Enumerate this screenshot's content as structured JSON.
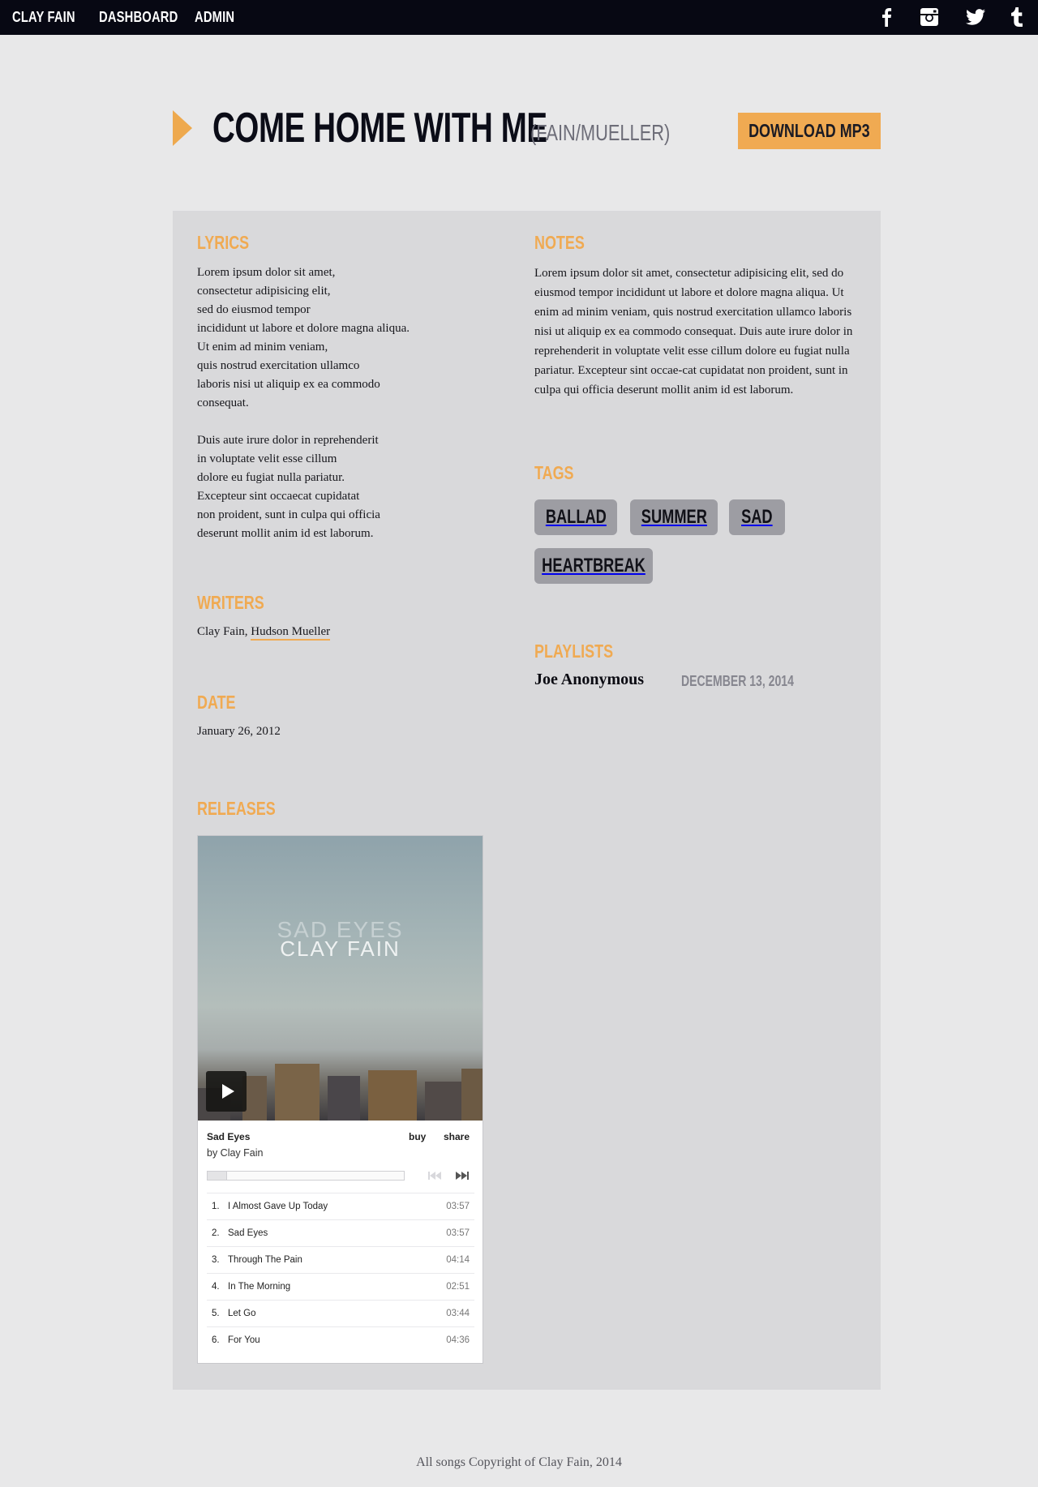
{
  "nav": {
    "brand": "CLAY FAIN",
    "links": [
      "DASHBOARD",
      "ADMIN"
    ],
    "social": [
      "facebook-icon",
      "instagram-icon",
      "twitter-icon",
      "tumblr-icon"
    ]
  },
  "song": {
    "title": "COME HOME WITH ME",
    "credit": "(FAIN/MUELLER)",
    "download_label": "DOWNLOAD MP3"
  },
  "lyrics": {
    "heading": "LYRICS",
    "lines": [
      "Lorem ipsum dolor sit amet,",
      "consectetur adipisicing elit,",
      "sed do eiusmod tempor",
      "incididunt ut labore et dolore magna aliqua.",
      "Ut enim ad minim veniam,",
      "quis nostrud exercitation ullamco",
      "laboris nisi ut aliquip ex ea commodo",
      "consequat.",
      "",
      "Duis aute irure dolor in reprehenderit",
      "in voluptate velit esse cillum",
      "dolore eu fugiat nulla pariatur.",
      "Excepteur sint occaecat cupidatat",
      "non proident, sunt in culpa qui officia",
      "deserunt mollit anim id est laborum."
    ]
  },
  "writers": {
    "heading": "WRITERS",
    "plain": "Clay Fain, ",
    "linked": "Hudson Mueller"
  },
  "date": {
    "heading": "DATE",
    "value": "January 26, 2012"
  },
  "releases": {
    "heading": "RELEASES",
    "cover_line1": "SAD EYES",
    "cover_line2": "CLAY FAIN",
    "album_title": "Sad Eyes",
    "album_artist": "by Clay Fain",
    "buy_label": "buy",
    "share_label": "share",
    "progress": 0.1,
    "tracks": [
      {
        "num": "1.",
        "name": "I Almost Gave Up Today",
        "time": "03:57"
      },
      {
        "num": "2.",
        "name": "Sad Eyes",
        "time": "03:57"
      },
      {
        "num": "3.",
        "name": "Through The Pain",
        "time": "04:14"
      },
      {
        "num": "4.",
        "name": "In The Morning",
        "time": "02:51"
      },
      {
        "num": "5.",
        "name": "Let Go",
        "time": "03:44"
      },
      {
        "num": "6.",
        "name": "For You",
        "time": "04:36"
      }
    ]
  },
  "notes": {
    "heading": "NOTES",
    "text": "Lorem ipsum dolor sit amet, consectetur adipisicing elit, sed do eiusmod tempor incididunt ut labore et dolore magna aliqua. Ut enim ad minim veniam, quis nostrud exercitation ullamco laboris nisi ut aliquip ex ea commodo consequat. Duis aute irure dolor in reprehenderit in voluptate velit esse cillum dolore eu fugiat nulla pariatur. Excepteur sint occae-cat cupidatat non proident, sunt in culpa qui officia deserunt mollit anim id est laborum."
  },
  "tags": {
    "heading": "TAGS",
    "items": [
      "BALLAD",
      "SUMMER",
      "SAD",
      "HEARTBREAK"
    ]
  },
  "playlists": {
    "heading": "PLAYLISTS",
    "items": [
      {
        "user": "Joe Anonymous",
        "date": "DECEMBER 13, 2014"
      }
    ]
  },
  "footer": {
    "copyright": "All songs Copyright of Clay Fain, 2014"
  },
  "colors": {
    "accent": "#f0aa52",
    "nav_bg": "#070813",
    "page_bg": "#e8e8e9",
    "panel_bg": "#d9d9db",
    "tag_bg": "#9d9da3"
  }
}
